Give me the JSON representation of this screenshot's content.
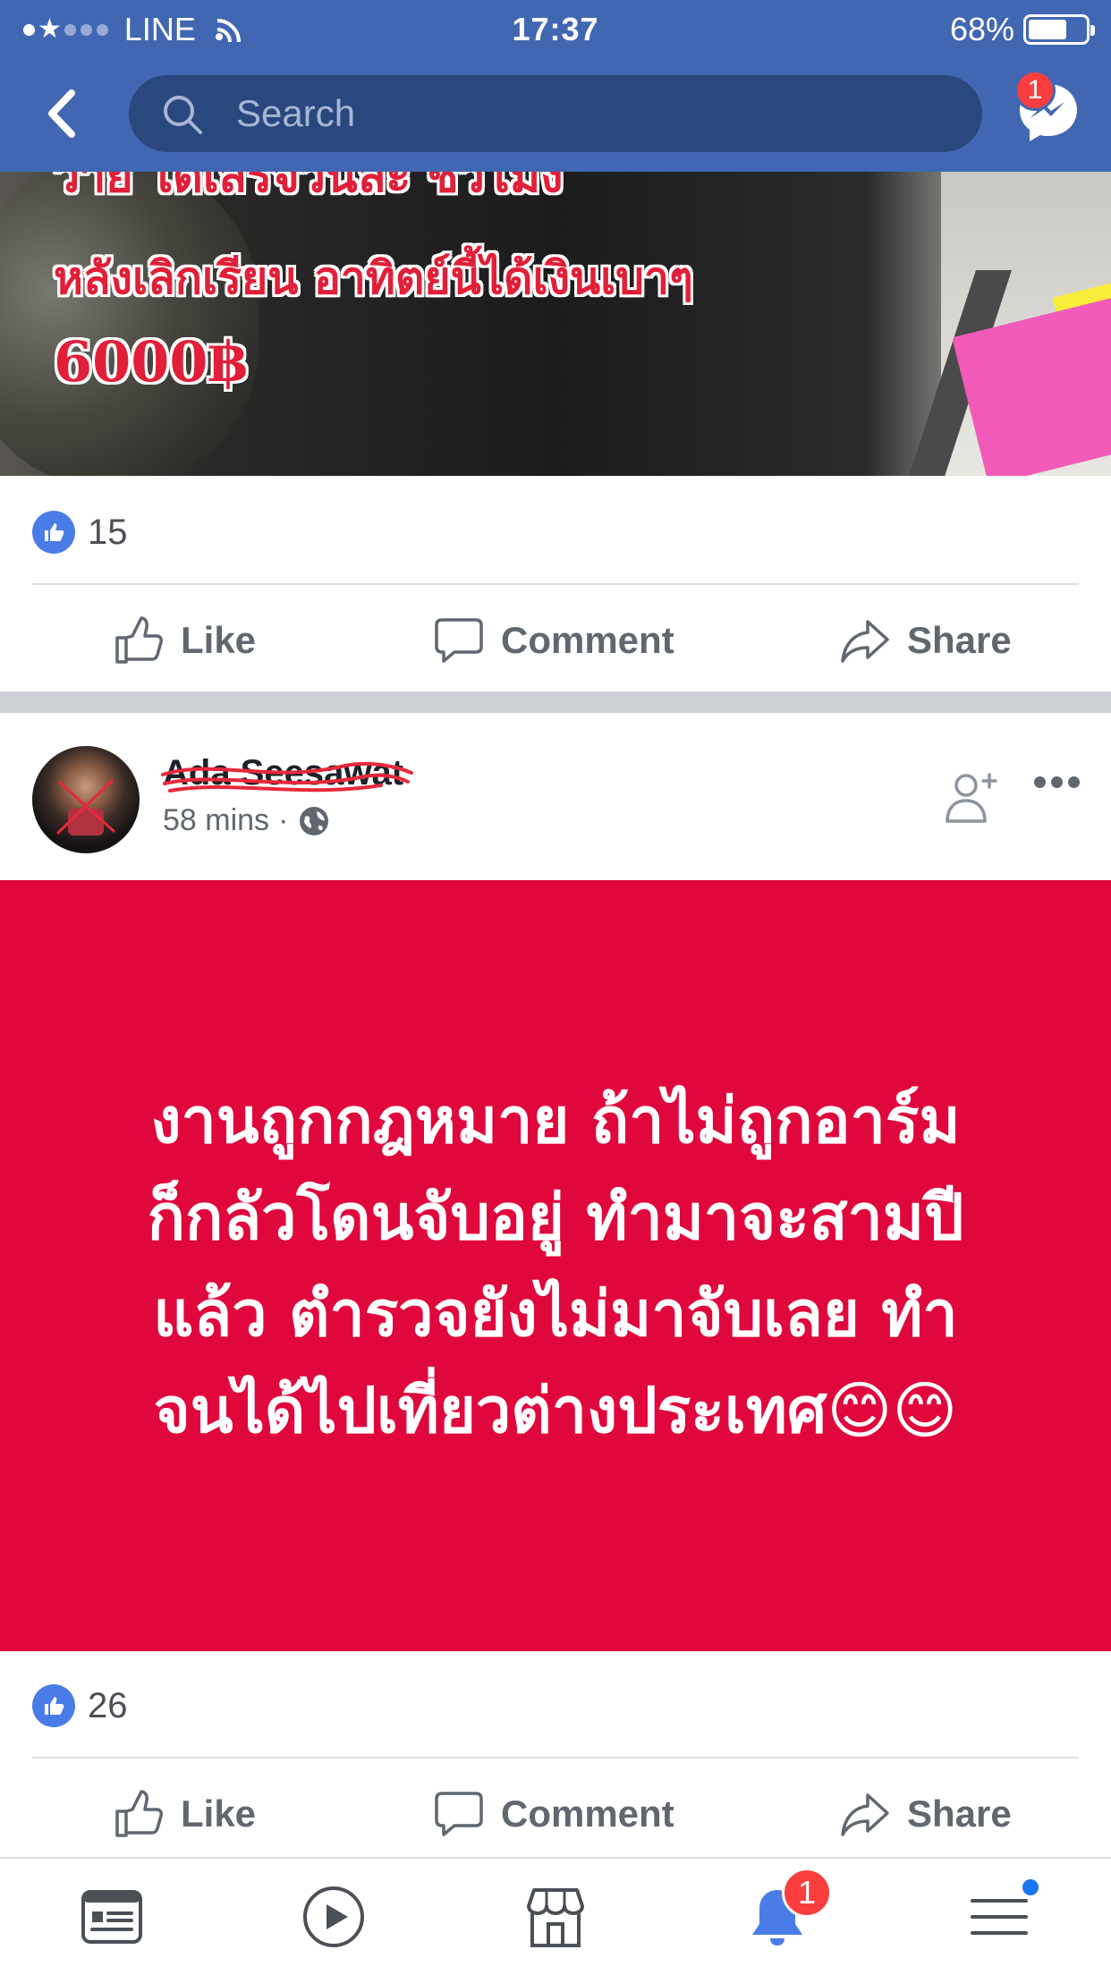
{
  "status_bar": {
    "carrier": "LINE",
    "time": "17:37",
    "battery_percent": "68%",
    "battery_level": 0.68
  },
  "header": {
    "search_placeholder": "Search",
    "messenger_badge": "1"
  },
  "colors": {
    "header_blue": "#4267b2",
    "search_field": "#29487d",
    "like_blue": "#4a7ce8",
    "text_card_red": "#e0073d",
    "badge_red": "#fa3e3e"
  },
  "post1": {
    "image_text": [
      "ว่าย ได้เสร็จวันละ ชั่วโมง",
      "หลังเลิกเรียน อาทิตย์นี้ได้เงินเบาๆ",
      "6000฿"
    ],
    "like_count": "15",
    "actions": {
      "like": "Like",
      "comment": "Comment",
      "share": "Share"
    }
  },
  "post2": {
    "author": "Ada Seesawat",
    "time": "58 mins",
    "meta_separator": "·",
    "text_lines": [
      "งานถูกกฎหมาย  ถ้าไม่ถูกอาร์ม",
      "ก็กลัวโดนจับอยู่ ทำมาจะสามปี",
      "แล้ว ตำรวจยังไม่มาจับเลย ทำ",
      "จนได้ไปเที่ยวต่างประเทศ😊😊"
    ],
    "like_count": "26",
    "actions": {
      "like": "Like",
      "comment": "Comment",
      "share": "Share"
    }
  },
  "tab_bar": {
    "icons": [
      "news-feed-icon",
      "watch-icon",
      "marketplace-icon",
      "notifications-icon",
      "menu-icon"
    ],
    "notifications_badge": "1"
  }
}
